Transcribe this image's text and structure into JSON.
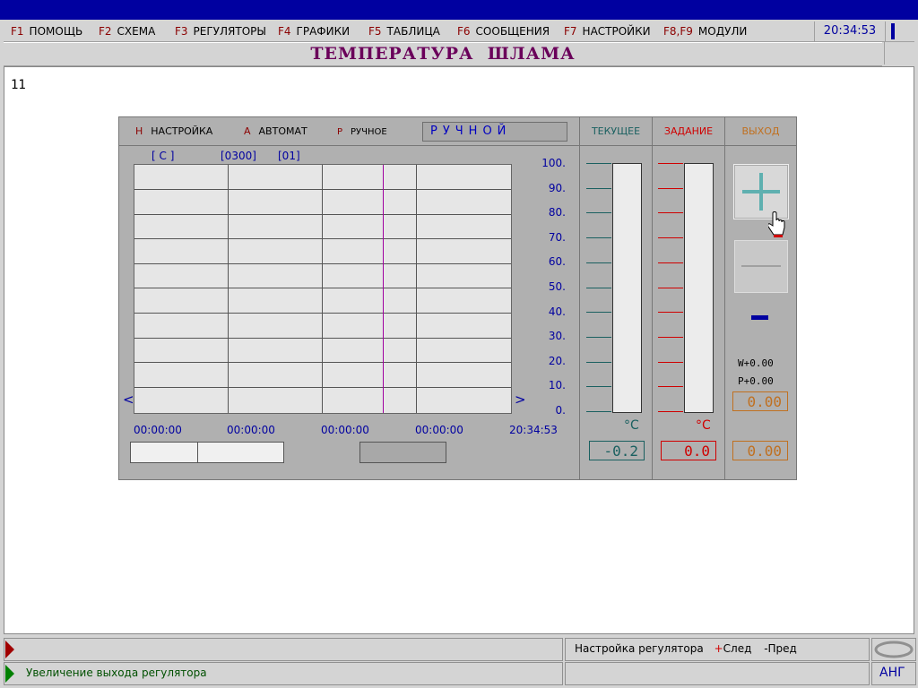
{
  "menu": [
    {
      "key": "F1",
      "label": "ПОМОЩЬ"
    },
    {
      "key": "F2",
      "label": "СХЕМА"
    },
    {
      "key": "F3",
      "label": "РЕГУЛЯТОРЫ"
    },
    {
      "key": "F4",
      "label": "ГРАФИКИ"
    },
    {
      "key": "F5",
      "label": "ТАБЛИЦА"
    },
    {
      "key": "F6",
      "label": "СООБЩЕНИЯ"
    },
    {
      "key": "F7",
      "label": "НАСТРОЙКИ"
    },
    {
      "key": "F8,F9",
      "label": "МОДУЛИ"
    }
  ],
  "clock": "20:34:53",
  "title": "ТЕМПЕРАТУРА  ШЛАМА",
  "page_number": "11",
  "panel": {
    "modes": [
      {
        "key": "Н",
        "label": "НАСТРОЙКА"
      },
      {
        "key": "А",
        "label": "АВТОМАТ"
      },
      {
        "key": "Р",
        "label": "РУЧНОЕ"
      }
    ],
    "mode_value": "РУЧНОЙ",
    "chart_header": {
      "unit": "[ С ]",
      "range": "[0300]",
      "page": "[01]"
    },
    "y_ticks": [
      "100.",
      "90.",
      "80.",
      "70.",
      "60.",
      "50.",
      "40.",
      "30.",
      "20.",
      "10.",
      "0."
    ],
    "x_ticks": [
      "00:00:00",
      "00:00:00",
      "00:00:00",
      "00:00:00",
      "20:34:53"
    ],
    "nav_left": "<",
    "nav_right": ">",
    "current": {
      "header": "ТЕКУЩЕЕ",
      "unit": "°C",
      "value": "-0.2",
      "level": 0.0
    },
    "setpoint": {
      "header": "ЗАДАНИЕ",
      "unit": "°C",
      "value": "0.0",
      "level": 0.0
    },
    "output": {
      "header": "ВЫХОД",
      "w_line": "W+0.00",
      "p_line": "P+0.00",
      "value_top": "0.00",
      "value_bottom": "0.00"
    }
  },
  "status": {
    "line1": "",
    "line2": "Увеличение выхода регулятора",
    "hint_prefix": "Настройка регулятора",
    "hint_next_key": "+",
    "hint_next": "След",
    "hint_prev": "-Пред",
    "lang": "АНГ"
  },
  "colors": {
    "title": "#6a005a",
    "current": "#1a6060",
    "setpoint": "#d00000",
    "output": "#c07020",
    "axis": "#0000a0"
  }
}
